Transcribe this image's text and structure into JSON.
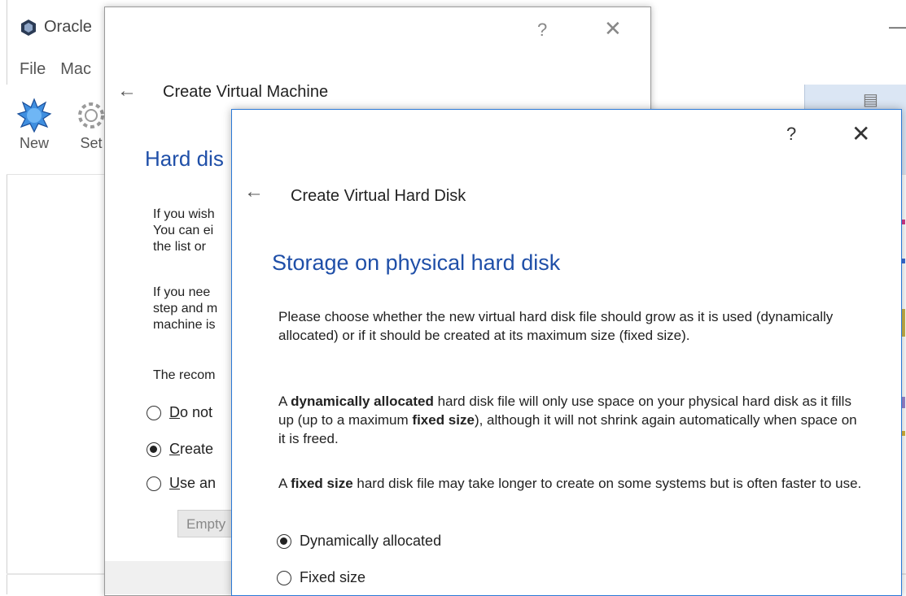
{
  "main_window": {
    "title": "Oracle",
    "menu": [
      "File",
      "Mac"
    ],
    "toolbar": [
      {
        "label": "New",
        "icon": "new-star-icon"
      },
      {
        "label": "Set",
        "icon": "settings-gear-icon"
      }
    ],
    "minimize_glyph": "—"
  },
  "dialog1": {
    "help_glyph": "?",
    "close_glyph": "✕",
    "back_glyph": "←",
    "title": "Create Virtual Machine",
    "heading": "Hard dis",
    "paragraph1": [
      "If you wish",
      "You can ei",
      "the list or"
    ],
    "paragraph2": [
      "If you nee",
      "step and m",
      "machine is"
    ],
    "paragraph3": "The recom",
    "options": [
      {
        "label_first": "D",
        "label_rest": "o not",
        "checked": false
      },
      {
        "label_first": "C",
        "label_rest": "reate",
        "checked": true
      },
      {
        "label_first": "U",
        "label_rest": "se an",
        "checked": false
      }
    ],
    "combo_value": "Empty"
  },
  "dialog2": {
    "help_glyph": "?",
    "close_glyph": "✕",
    "back_glyph": "←",
    "title": "Create Virtual Hard Disk",
    "heading": "Storage on physical hard disk",
    "paragraph1": "Please choose whether the new virtual hard disk file should grow as it is used (dynamically allocated) or if it should be created at its maximum size (fixed size).",
    "paragraph2": {
      "a": "A ",
      "b": "dynamically allocated",
      "c": " hard disk file will only use space on your physical hard disk as it fills up (up to a maximum ",
      "d": "fixed size",
      "e": "), although it will not shrink again automatically when space on it is freed."
    },
    "paragraph3": {
      "a": "A ",
      "b": "fixed size",
      "c": " hard disk file may take longer to create on some systems but is often faster to use."
    },
    "options": [
      {
        "label": "Dynamically allocated",
        "checked": true
      },
      {
        "label": "Fixed size",
        "checked": false
      }
    ]
  },
  "colors": {
    "accent_blue": "#1f4fa8",
    "dialog_border": "#2b79d6",
    "panel_blue": "#dbe6f4"
  }
}
